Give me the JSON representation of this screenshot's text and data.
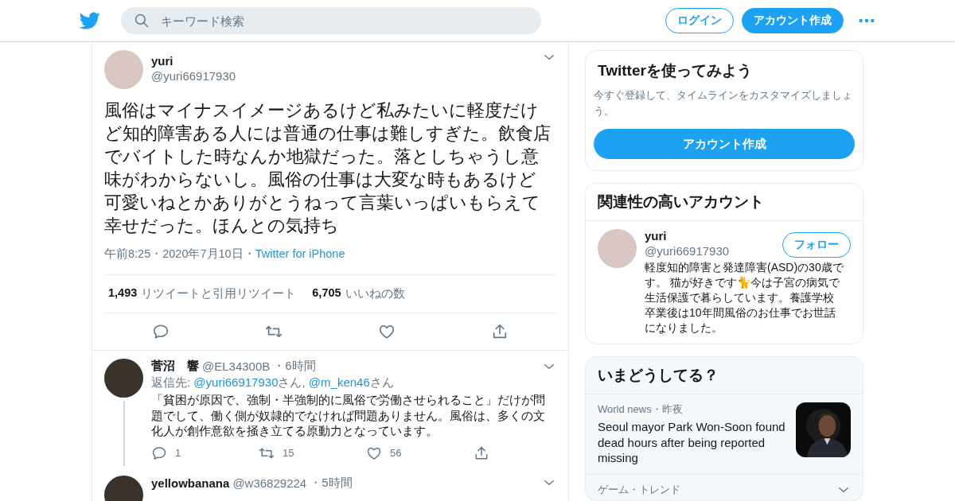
{
  "header": {
    "search": {
      "placeholder": "キーワード検索"
    },
    "login": "ログイン",
    "signup": "アカウント作成"
  },
  "tweet": {
    "name": "yuri",
    "handle": "@yuri66917930",
    "text": "風俗はマイナスイメージあるけど私みたいに軽度だけど知的障害ある人には普通の仕事は難しすぎた。飲食店でバイトした時なんか地獄だった。落としちゃうし意味がわからないし。風俗の仕事は大変な時もあるけど可愛いねとかありがとうねって言葉いっぱいもらえて幸せだった。ほんとの気持ち",
    "time": "午前8:25・2020年7月10日・",
    "source": "Twitter for iPhone",
    "stats": [
      {
        "count": "1,493",
        "label": "リツイートと引用リツイート"
      },
      {
        "count": "6,705",
        "label": "いいねの数"
      }
    ]
  },
  "replies": [
    {
      "name": "菅沼　響",
      "handle": "@EL34300B",
      "time": "・6時間",
      "reply_to": {
        "prefix": "返信先:",
        "mentions": [
          {
            "handle": "@yuri66917930",
            "suffix": "さん,"
          },
          {
            "handle": "@m_ken46",
            "suffix": "さん"
          }
        ]
      },
      "text": "「貧困が原因で、強制・半強制的に風俗で労働させられること」だけが問題でして、働く側が奴隷的でなければ問題ありません。風俗は、多くの文化人が創作意欲を掻き立てる原動力となっています。",
      "counts": {
        "reply": "1",
        "retweet": "15",
        "like": "56"
      }
    },
    {
      "name": "yellowbanana",
      "handle": "@w36829224",
      "time": "・5時間"
    }
  ],
  "sidebar": {
    "signup_card": {
      "title": "Twitterを使ってみよう",
      "text": "今すぐ登録して、タイムラインをカスタマイズしましょう。",
      "button": "アカウント作成"
    },
    "related": {
      "title": "関連性の高いアカウント",
      "accounts": [
        {
          "name": "yuri",
          "handle": "@yuri66917930",
          "follow": "フォロー",
          "bio": "軽度知的障害と発達障害(ASD)の30歳です。 猫が好きです🐈今は子宮の病気で生活保護で暮らしています。養護学校卒業後は10年間風俗のお仕事でお世話になりました。"
        }
      ]
    },
    "trends": {
      "title": "いまどうしてる？",
      "items": [
        {
          "kind": "news",
          "meta": "World news・昨夜",
          "title": "Seoul mayor Park Won-Soon found dead hours after being reported missing"
        },
        {
          "kind": "trend",
          "meta": "ゲーム・トレンド"
        }
      ]
    }
  }
}
